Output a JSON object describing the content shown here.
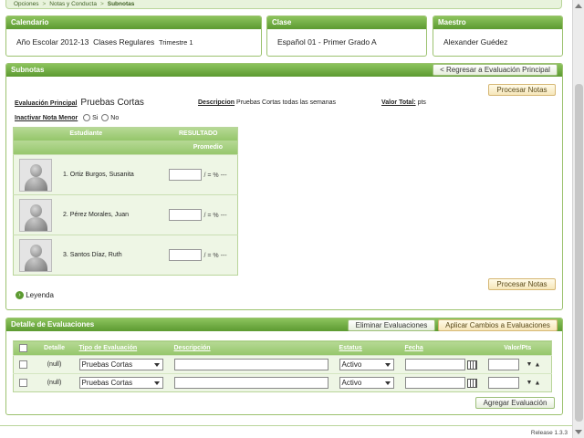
{
  "breadcrumb": {
    "items": [
      "Opciones",
      "Notas y Conducta",
      "Subnotas"
    ]
  },
  "calendario": {
    "title": "Calendario",
    "year": "Año Escolar 2012-13",
    "mode": "Clases Regulares",
    "term": "Trimestre 1"
  },
  "clase": {
    "title": "Clase",
    "value": "Español 01 -  Primer Grado  A"
  },
  "maestro": {
    "title": "Maestro",
    "value": "Alexander Guédez"
  },
  "subnotas": {
    "title": "Subnotas",
    "back_label": "< Regresar a Evaluación Principal",
    "process_label": "Procesar Notas",
    "eval_label": "Evaluación Principal",
    "eval_value": "Pruebas Cortas",
    "desc_label": "Descripcion",
    "desc_value": "Pruebas Cortas todas las semanas",
    "total_label": "Valor Total:",
    "total_value": "pts",
    "inactivar_label": "Inactivar Nota Menor",
    "opt_si": "Si",
    "opt_no": "No",
    "legend_label": "Leyenda",
    "table": {
      "col_student": "Estudiante",
      "col_result": "RESULTADO",
      "col_avg": "Promedio",
      "suffix": "/ = % ---",
      "students": [
        {
          "name": "1. Ortiz Burgos, Susanita"
        },
        {
          "name": "2. Pérez Morales, Juan"
        },
        {
          "name": "3. Santos Díaz, Ruth"
        }
      ]
    }
  },
  "detalle": {
    "title": "Detalle de Evaluaciones",
    "delete_label": "Eliminar Evaluaciones",
    "apply_label": "Aplicar Cambios a Evaluaciones",
    "add_label": "Agregar Evaluación",
    "headers": {
      "detalle": "Detalle",
      "tipo": "Tipo de Evaluación",
      "descripcion": "Descripción",
      "estatus": "Estatus",
      "fecha": "Fecha",
      "valor": "Valor/Pts"
    },
    "rows": [
      {
        "detalle": "(null)",
        "tipo": "Pruebas Cortas",
        "estatus": "Activo"
      },
      {
        "detalle": "(null)",
        "tipo": "Pruebas Cortas",
        "estatus": "Activo"
      }
    ]
  },
  "footer": {
    "release": "Release 1.3.3"
  }
}
